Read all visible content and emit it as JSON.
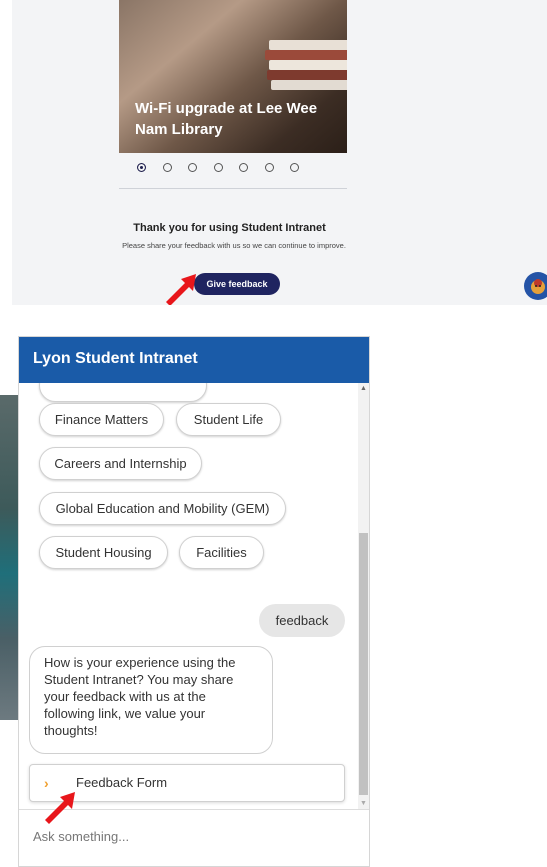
{
  "top": {
    "banner_title": "Wi-Fi upgrade at Lee Wee Nam Library",
    "carousel": {
      "count": 7,
      "active_index": 0
    },
    "thanks_title": "Thank you for using Student Intranet",
    "thanks_message": "Please share your feedback with us so we can continue to improve.",
    "feedback_button": "Give feedback"
  },
  "chat": {
    "title": "Lyon Student Intranet",
    "chips": [
      {
        "label": "Finance Matters"
      },
      {
        "label": "Student Life"
      },
      {
        "label": "Careers and Internship"
      },
      {
        "label": "Global Education and Mobility (GEM)"
      },
      {
        "label": "Student Housing"
      },
      {
        "label": "Facilities"
      }
    ],
    "user_message": "feedback",
    "bot_message": "How is your experience using the Student Intranet? You may share your feedback with us at the following link, we value your thoughts!",
    "form_link": "Feedback Form",
    "input_placeholder": "Ask something..."
  },
  "colors": {
    "chat_header": "#1a5ba8",
    "feedback_button": "#1f2460",
    "arrow": "#e8161b",
    "chevron": "#f0a030"
  },
  "icons": [
    "annotation-arrow",
    "chevron-right-icon",
    "chatbot-avatar-icon"
  ]
}
